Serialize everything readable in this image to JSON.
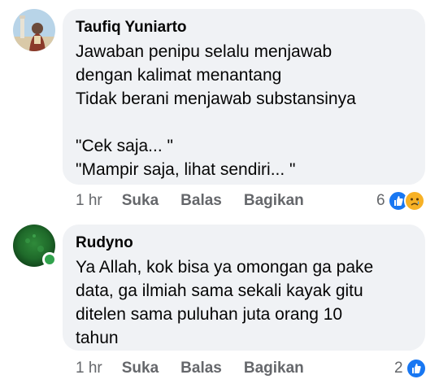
{
  "comments": [
    {
      "author": "Taufiq Yuniarto",
      "text": "Jawaban penipu selalu menjawab\ndengan kalimat menantang\nTidak berani menjawab substansinya\n\n\"Cek saja... \"\n\"Mampir saja, lihat sendiri... \"",
      "time": "1 hr",
      "like_label": "Suka",
      "reply_label": "Balas",
      "share_label": "Bagikan",
      "reaction_count": "6",
      "reactions": [
        "like-icon",
        "sad-icon"
      ]
    },
    {
      "author": "Rudyno",
      "text": "Ya Allah, kok bisa ya omongan ga pake\ndata, ga ilmiah sama sekali kayak gitu\nditelen sama puluhan juta orang 10\ntahun",
      "time": "1 hr",
      "like_label": "Suka",
      "reply_label": "Balas",
      "share_label": "Bagikan",
      "reaction_count": "2",
      "reactions": [
        "like-icon"
      ],
      "online": true
    }
  ],
  "colors": {
    "bubble": "#f0f2f5",
    "meta_text": "#65676b",
    "like_blue": "#1877f2",
    "online_green": "#31a24c"
  }
}
